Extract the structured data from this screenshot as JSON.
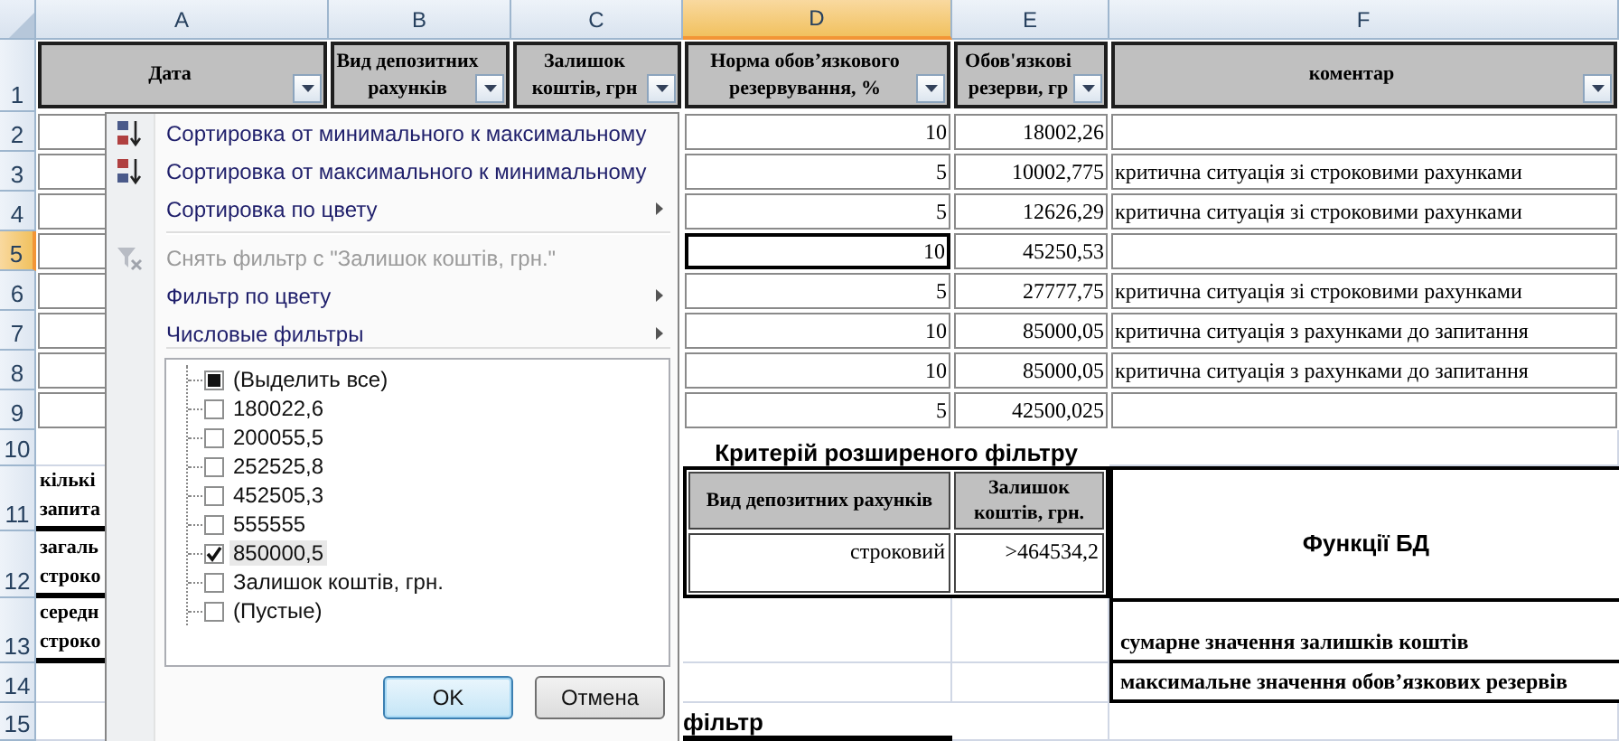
{
  "column_headers": [
    {
      "label": "A",
      "selected": false
    },
    {
      "label": "B",
      "selected": false
    },
    {
      "label": "C",
      "selected": false
    },
    {
      "label": "D",
      "selected": true
    },
    {
      "label": "E",
      "selected": false
    },
    {
      "label": "F",
      "selected": false
    }
  ],
  "row_headers": [
    {
      "label": "1",
      "selected": false
    },
    {
      "label": "2",
      "selected": false
    },
    {
      "label": "3",
      "selected": false
    },
    {
      "label": "4",
      "selected": false
    },
    {
      "label": "5",
      "selected": true
    },
    {
      "label": "6",
      "selected": false
    },
    {
      "label": "7",
      "selected": false
    },
    {
      "label": "8",
      "selected": false
    },
    {
      "label": "9",
      "selected": false
    },
    {
      "label": "10",
      "selected": false
    },
    {
      "label": "11",
      "selected": false
    },
    {
      "label": "12",
      "selected": false
    },
    {
      "label": "13",
      "selected": false
    },
    {
      "label": "14",
      "selected": false
    },
    {
      "label": "15",
      "selected": false
    }
  ],
  "table": {
    "columns": [
      {
        "label": "Дата"
      },
      {
        "label": "Вид депозитних рахунків"
      },
      {
        "label": "Залишок коштів, грн"
      },
      {
        "label": "Норма обов’язкового резервування, %"
      },
      {
        "label": "Обов'язкові резерви, гр"
      },
      {
        "label": "коментар"
      }
    ],
    "rows": [
      {
        "rate": "10",
        "reserve": "18002,26",
        "active": false
      },
      {
        "rate": "5",
        "reserve": "10002,775",
        "comment": "критична ситуація зі строковими рахунками",
        "active": false
      },
      {
        "rate": "5",
        "reserve": "12626,29",
        "comment": "критична ситуація зі строковими рахунками",
        "active": false
      },
      {
        "rate": "10",
        "reserve": "45250,53",
        "active": true
      },
      {
        "rate": "5",
        "reserve": "27777,75",
        "comment": "критична ситуація зі строковими рахунками",
        "active": false
      },
      {
        "rate": "10",
        "reserve": "85000,05",
        "comment": "критична ситуація з рахунками до запитання",
        "active": false
      },
      {
        "rate": "10",
        "reserve": "85000,05",
        "comment": "критична ситуація з рахунками до запитання",
        "active": false
      },
      {
        "rate": "5",
        "reserve": "42500,025",
        "active": false
      }
    ]
  },
  "criteria": {
    "title": "Критерій розширеного фільтру",
    "columns": [
      "Вид депозитних рахунків",
      "Залишок коштів, грн."
    ],
    "values": [
      "строковий",
      ">464534,2"
    ]
  },
  "functions": {
    "title": "Функції БД",
    "items": [
      "сумарне значення залишків коштів",
      "максимальне значення обов’язкових резервів"
    ]
  },
  "side_labels": [
    [
      "кількі",
      "запита"
    ],
    [
      "загаль",
      "строко"
    ],
    [
      "середн",
      "строко"
    ]
  ],
  "footer_label": "фільтр",
  "filter_menu": {
    "items": [
      {
        "kind": "sort-asc",
        "label": "Сортировка от минимального к максимальному",
        "disabled": false,
        "submenu": false
      },
      {
        "kind": "sort-desc",
        "label": "Сортировка от максимального к минимальному",
        "disabled": false,
        "submenu": false
      },
      {
        "kind": "plain",
        "label": "Сортировка по цвету",
        "disabled": false,
        "submenu": true
      },
      {
        "kind": "separator"
      },
      {
        "kind": "clear-filter",
        "label": "Снять фильтр с \"Залишок коштів, грн.\"",
        "disabled": true,
        "submenu": false
      },
      {
        "kind": "plain",
        "label": "Фильтр по цвету",
        "disabled": false,
        "submenu": true
      },
      {
        "kind": "plain",
        "label": "Числовые фильтры",
        "disabled": false,
        "submenu": true
      }
    ],
    "values": [
      {
        "label": "(Выделить все)",
        "checked": false,
        "indeterminate": true,
        "selected": false
      },
      {
        "label": "180022,6",
        "checked": false,
        "indeterminate": false,
        "selected": false
      },
      {
        "label": "200055,5",
        "checked": false,
        "indeterminate": false,
        "selected": false
      },
      {
        "label": "252525,8",
        "checked": false,
        "indeterminate": false,
        "selected": false
      },
      {
        "label": "452505,3",
        "checked": false,
        "indeterminate": false,
        "selected": false
      },
      {
        "label": "555555",
        "checked": false,
        "indeterminate": false,
        "selected": false
      },
      {
        "label": "850000,5",
        "checked": true,
        "indeterminate": false,
        "selected": true
      },
      {
        "label": "Залишок коштів, грн.",
        "checked": false,
        "indeterminate": false,
        "selected": false
      },
      {
        "label": "(Пустые)",
        "checked": false,
        "indeterminate": false,
        "selected": false
      }
    ],
    "buttons": [
      {
        "label": "OK",
        "default": true
      },
      {
        "label": "Отмена",
        "default": false
      }
    ]
  }
}
